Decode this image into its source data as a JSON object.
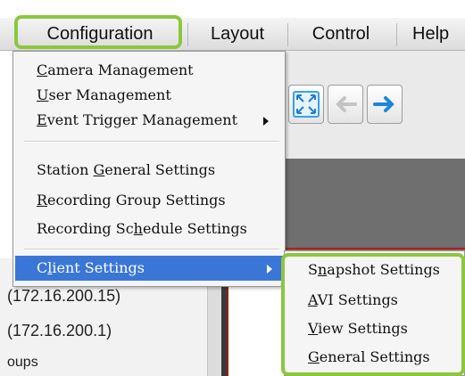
{
  "menubar": {
    "items": [
      {
        "label": "Configuration"
      },
      {
        "label": "Layout"
      },
      {
        "label": "Control"
      },
      {
        "label": "Help"
      }
    ]
  },
  "configuration_menu": {
    "items": [
      {
        "label": "Camera Management",
        "mnemonic": "C",
        "rest": "amera Management"
      },
      {
        "label": "User Management",
        "mnemonic": "U",
        "rest": "ser Management"
      },
      {
        "label": "Event Trigger Management",
        "mnemonic": "E",
        "rest": "vent Trigger Management",
        "has_submenu": true
      },
      {
        "label": "Station General Settings",
        "pre": "Station ",
        "mnemonic": "G",
        "rest": "eneral Settings"
      },
      {
        "label": "Recording Group Settings",
        "mnemonic": "R",
        "rest": "ecording Group Settings"
      },
      {
        "label": "Recording Schedule Settings",
        "pre": "Recording Sc",
        "mnemonic": "h",
        "rest": "edule Settings"
      },
      {
        "label": "Client Settings",
        "pre": "C",
        "mnemonic": "l",
        "rest": "ient Settings",
        "has_submenu": true,
        "selected": true
      }
    ]
  },
  "client_settings_submenu": {
    "items": [
      {
        "label": "Snapshot Settings",
        "pre": "S",
        "mnemonic": "n",
        "rest": "apshot Settings"
      },
      {
        "label": "AVI Settings",
        "mnemonic": "A",
        "rest": "VI Settings"
      },
      {
        "label": "View Settings",
        "mnemonic": "V",
        "rest": "iew Settings"
      },
      {
        "label": "General Settings",
        "mnemonic": "G",
        "rest": "eneral Settings"
      }
    ]
  },
  "left_panel": {
    "items": [
      "(172.16.200.15)",
      "(172.16.200.1)",
      "oups"
    ]
  },
  "colors": {
    "highlight_outline": "#8dc63f",
    "selection": "#3a76d6",
    "forward_arrow": "#1f86d6"
  },
  "icons": {
    "fullscreen": "fullscreen-icon",
    "back": "arrow-left-icon",
    "forward": "arrow-right-icon",
    "submenu_arrow": "triangle-right-icon"
  }
}
